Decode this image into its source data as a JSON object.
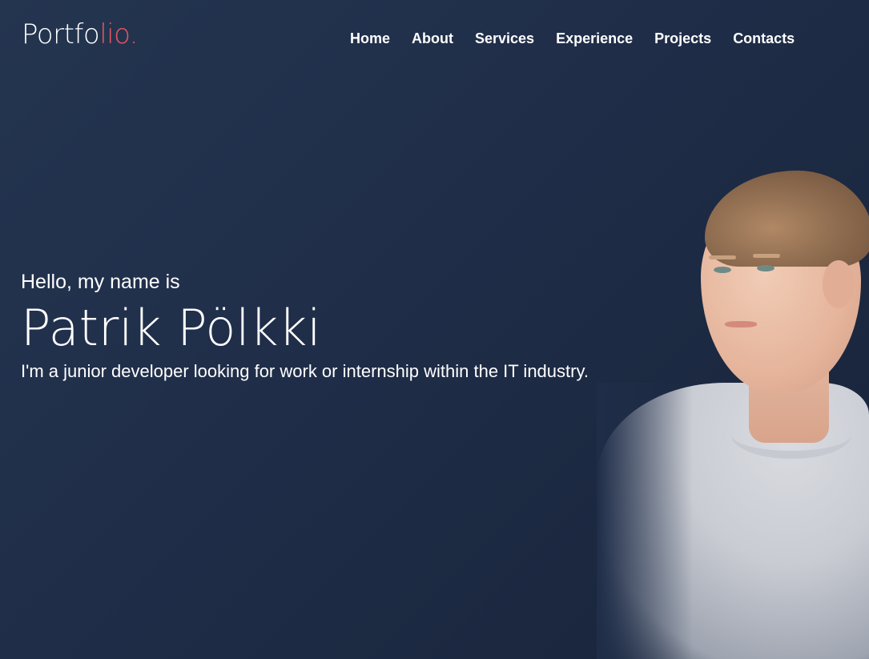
{
  "header": {
    "logo": {
      "main": "Portfo",
      "accent": "lio."
    },
    "nav": [
      {
        "label": "Home"
      },
      {
        "label": "About"
      },
      {
        "label": "Services"
      },
      {
        "label": "Experience"
      },
      {
        "label": "Projects"
      },
      {
        "label": "Contacts"
      }
    ]
  },
  "hero": {
    "greeting": "Hello, my name is",
    "name": "Patrik Pölkki",
    "tagline": "I'm a junior developer looking for work or internship within the IT industry."
  },
  "colors": {
    "background": "#1f2d48",
    "accent": "#e4585f",
    "text": "#ffffff"
  },
  "icons": {
    "portrait": "profile-photo"
  }
}
